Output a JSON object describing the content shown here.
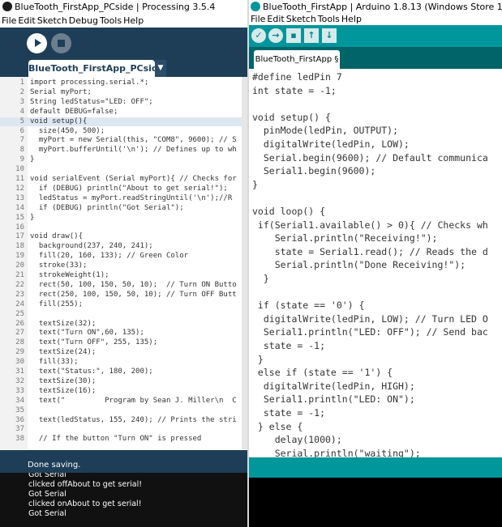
{
  "processing": {
    "title": "BlueTooth_FirstApp_PCside | Processing 3.5.4",
    "menu": [
      "File",
      "Edit",
      "Sketch",
      "Debug",
      "Tools",
      "Help"
    ],
    "tab_label": "BlueTooth_FirstApp_PCside",
    "tab_menu_glyph": "▼",
    "code_lines": [
      {
        "n": "1",
        "t": "import processing.serial.*;"
      },
      {
        "n": "2",
        "t": "Serial myPort;"
      },
      {
        "n": "3",
        "t": "String ledStatus=\"LED: OFF\";"
      },
      {
        "n": "4",
        "t": "default DEBUG=false;"
      },
      {
        "n": "5",
        "t": "void setup(){"
      },
      {
        "n": "6",
        "t": "  size(450, 500);"
      },
      {
        "n": "7",
        "t": "  myPort = new Serial(this, \"COM8\", 9600); // S"
      },
      {
        "n": "8",
        "t": "  myPort.bufferUntil('\\n'); // Defines up to wh"
      },
      {
        "n": "9",
        "t": "}"
      },
      {
        "n": "10",
        "t": ""
      },
      {
        "n": "11",
        "t": "void serialEvent (Serial myPort){ // Checks for"
      },
      {
        "n": "12",
        "t": "  if (DEBUG) println(\"About to get serial!\");"
      },
      {
        "n": "13",
        "t": "  ledStatus = myPort.readStringUntil('\\n');//R"
      },
      {
        "n": "14",
        "t": "  if (DEBUG) println(\"Got Serial\");"
      },
      {
        "n": "15",
        "t": "}"
      },
      {
        "n": "16",
        "t": ""
      },
      {
        "n": "17",
        "t": "void draw(){"
      },
      {
        "n": "18",
        "t": "  background(237, 240, 241);"
      },
      {
        "n": "19",
        "t": "  fill(20, 160, 133); // Green Color"
      },
      {
        "n": "20",
        "t": "  stroke(33);"
      },
      {
        "n": "21",
        "t": "  strokeWeight(1);"
      },
      {
        "n": "22",
        "t": "  rect(50, 100, 150, 50, 10);  // Turn ON Butto"
      },
      {
        "n": "23",
        "t": "  rect(250, 100, 150, 50, 10); // Turn OFF Butt"
      },
      {
        "n": "24",
        "t": "  fill(255);"
      },
      {
        "n": "25",
        "t": ""
      },
      {
        "n": "26",
        "t": "  textSize(32);"
      },
      {
        "n": "27",
        "t": "  text(\"Turn ON\",60, 135);"
      },
      {
        "n": "28",
        "t": "  text(\"Turn OFF\", 255, 135);"
      },
      {
        "n": "29",
        "t": "  textSize(24);"
      },
      {
        "n": "30",
        "t": "  fill(33);"
      },
      {
        "n": "31",
        "t": "  text(\"Status:\", 180, 200);"
      },
      {
        "n": "32",
        "t": "  textSize(30);"
      },
      {
        "n": "33",
        "t": "  textSize(16);"
      },
      {
        "n": "34",
        "t": "  text(\"         Program by Sean J. Miller\\n  C"
      },
      {
        "n": "35",
        "t": ""
      },
      {
        "n": "36",
        "t": "  text(ledStatus, 155, 240); // Prints the stri"
      },
      {
        "n": "37",
        "t": ""
      },
      {
        "n": "38",
        "t": "  // If the button \"Turn ON\" is pressed"
      }
    ],
    "status_text": "Done saving.",
    "console_lines": [
      "Got Serial",
      "clicked offAbout to get serial!",
      "Got Serial",
      "clicked onAbout to get serial!",
      "Got Serial"
    ],
    "colors": {
      "toolbar": "#1e3e58",
      "console": "#111111"
    }
  },
  "arduino": {
    "title": "BlueTooth_FirstApp | Arduino 1.8.13 (Windows Store 1.8.42.0)",
    "menu": [
      "File",
      "Edit",
      "Sketch",
      "Tools",
      "Help"
    ],
    "toolbar_icons": [
      "verify-icon",
      "upload-icon",
      "new-icon",
      "open-icon",
      "save-icon"
    ],
    "tab_label": "BlueTooth_FirstApp §",
    "code_lines": [
      "#define ledPin 7",
      "int state = -1;",
      "",
      "void setup() {",
      "  pinMode(ledPin, OUTPUT);",
      "  digitalWrite(ledPin, LOW);",
      "  Serial.begin(9600); // Default communica",
      "  Serial1.begin(9600);",
      "}",
      "",
      "void loop() {",
      " if(Serial1.available() > 0){ // Checks wh",
      "    Serial.println(\"Receiving!\");",
      "    state = Serial1.read(); // Reads the d",
      "    Serial.println(\"Done Receiving!\");",
      "  }",
      "",
      " if (state == '0') {",
      "  digitalWrite(ledPin, LOW); // Turn LED O",
      "  Serial1.println(\"LED: OFF\"); // Send bac",
      "  state = -1;",
      " }",
      " else if (state == '1') {",
      "  digitalWrite(ledPin, HIGH);",
      "  Serial1.println(\"LED: ON\");",
      "  state = -1;",
      " } else {",
      "    delay(1000);",
      "    Serial.println(\"waiting\");"
    ],
    "colors": {
      "toolbar": "#00979c",
      "tabstrip": "#006468",
      "console": "#000000"
    }
  }
}
